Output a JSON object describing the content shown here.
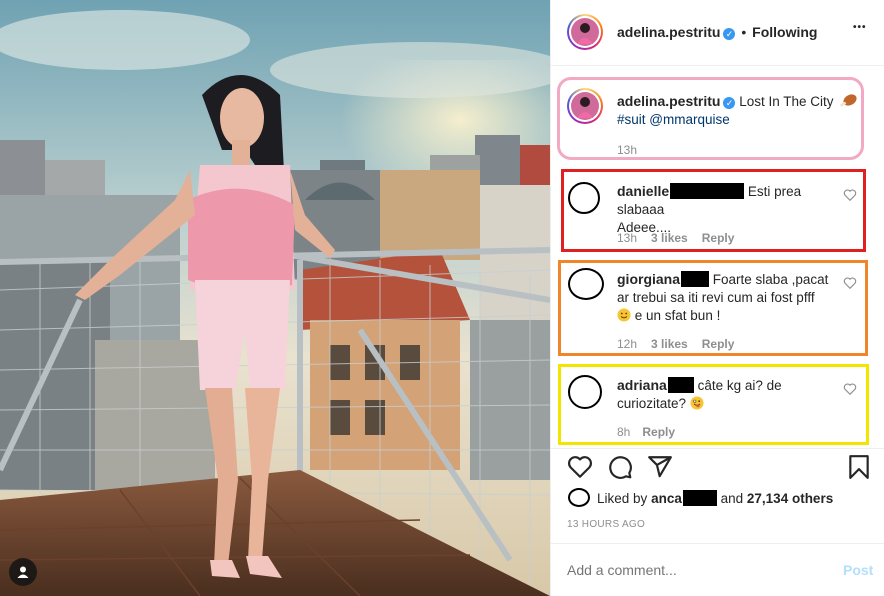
{
  "post": {
    "author": "adelina.pestritu",
    "follow_status": "Following",
    "dot": "•",
    "more": "•••",
    "caption_text": "Lost In The City",
    "caption_hashtag": "#suit",
    "caption_mention": "@mmarquise",
    "caption_time": "13h"
  },
  "comments": [
    {
      "user": "danielle",
      "text_line1": "Esti prea slabaaa",
      "text_line2": "Adeee....",
      "time": "13h",
      "likes": "3 likes",
      "reply": "Reply",
      "highlight": "#e02020"
    },
    {
      "user": "giorgiana",
      "text_line1": "Foarte slaba ,pacat",
      "text_line2": "ar trebui sa iti revi cum ai fost pfff",
      "text_line3": "e un sfat bun !",
      "time": "12h",
      "likes": "3 likes",
      "reply": "Reply",
      "highlight": "#f0852a"
    },
    {
      "user": "adriana",
      "text_line1": "câte kg ai? de",
      "text_line2": "curiozitate?",
      "time": "8h",
      "reply": "Reply",
      "highlight": "#f2e500"
    }
  ],
  "caption_highlight": "#f2a9c4",
  "likes": {
    "prefix": "Liked by",
    "user": "anca",
    "and": "and",
    "count": "27,134 others"
  },
  "time_ago": "13 HOURS AGO",
  "comment_input": {
    "placeholder": "Add a comment...",
    "post_label": "Post"
  },
  "icons": [
    "user-tag-icon",
    "verified-icon",
    "more-icon",
    "heart-icon",
    "comment-icon",
    "share-icon",
    "bookmark-icon",
    "emoji-icon"
  ]
}
